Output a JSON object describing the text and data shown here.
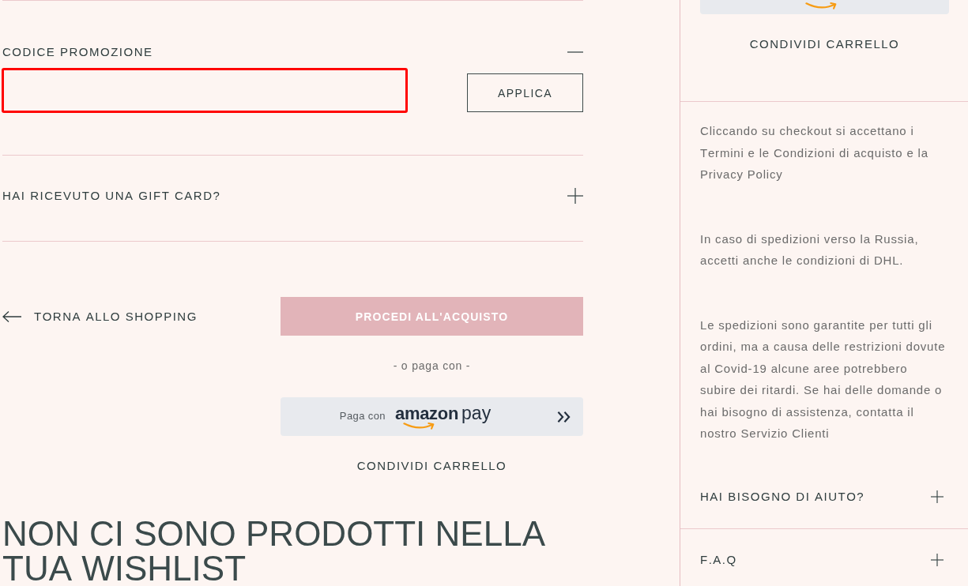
{
  "cart_panel": {
    "accordions": [
      {
        "title": "CODICE PROMOZIONE",
        "expanded": true,
        "code_field": {
          "highlighted": true
        },
        "apply_button": "APPLICA"
      },
      {
        "title": "HAI RICEVUTO UNA GIFT CARD?",
        "expanded": false
      }
    ],
    "back_link": "TORNA ALLO SHOPPING",
    "checkout_button": {
      "label": "PROCEDI ALL'ACQUISTO",
      "disabled": true
    },
    "alt_payment_label": "- o paga con -",
    "amazon_pay_button": {
      "prefix": "Paga con",
      "brand": "amazon",
      "suffix": "pay"
    },
    "share_cart_link": "CONDIVIDI CARRELLO"
  },
  "wishlist": {
    "empty_message": "NON CI SONO PRODOTTI NELLA TUA WISHLIST"
  },
  "sidebar": {
    "share_cart_link": "CONDIVIDI CARRELLO",
    "notes": [
      "Cliccando su checkout si accettano i Termini e le Condizioni di acquisto e la Privacy Policy",
      "In caso di spedizioni verso la Russia, accetti anche le condizioni di DHL.",
      "Le spedizioni sono garantite per tutti gli ordini, ma a causa delle restrizioni dovute al Covid-19 alcune aree potrebbero subire dei ritardi. Se hai delle domande o hai bisogno di assistenza, contatta il nostro Servizio Clienti"
    ],
    "accordions": [
      {
        "title": "HAI BISOGNO DI AIUTO?",
        "expanded": false
      },
      {
        "title": "F.A.Q",
        "expanded": false
      }
    ]
  }
}
